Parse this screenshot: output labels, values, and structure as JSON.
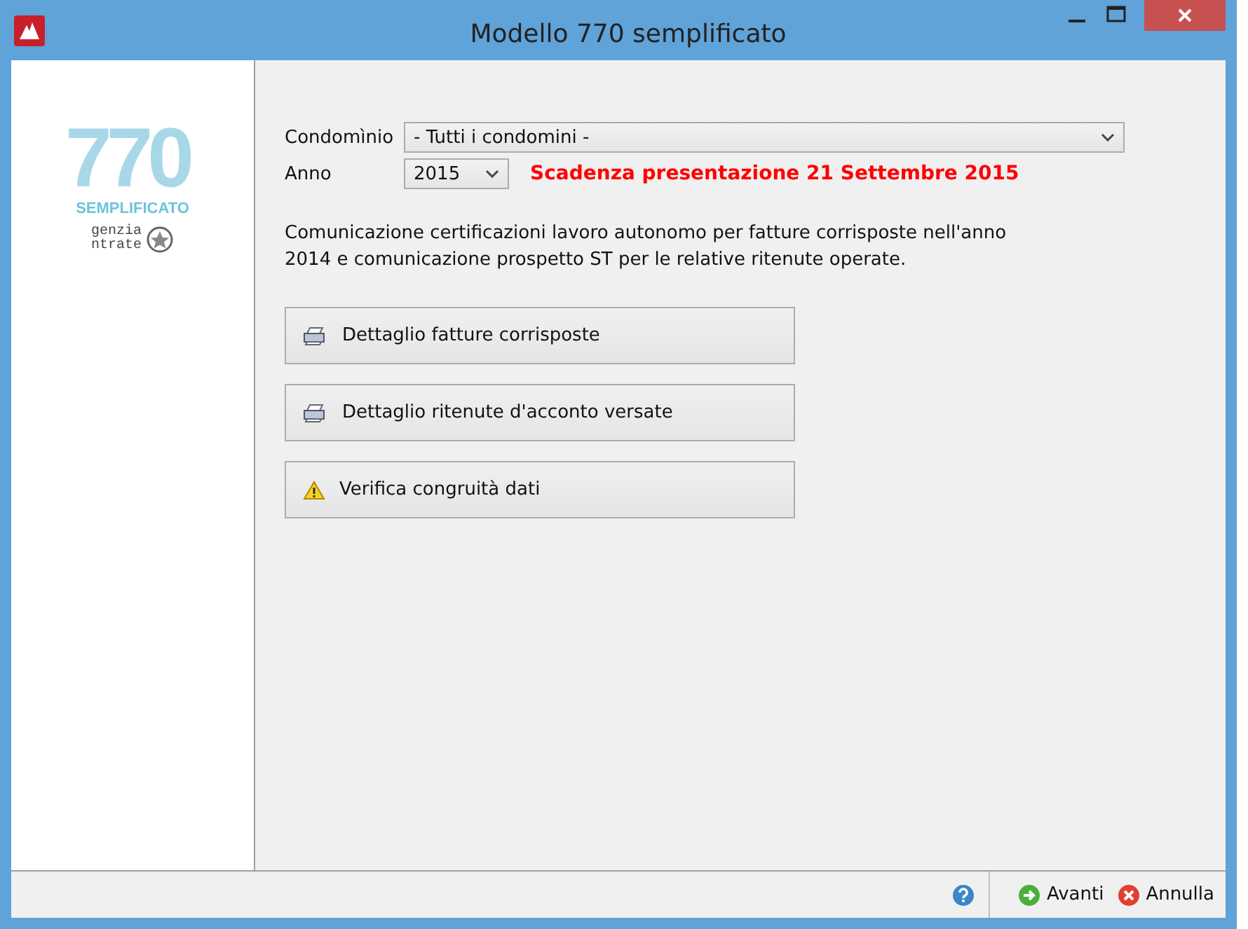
{
  "window": {
    "title": "Modello 770 semplificato"
  },
  "logo": {
    "number": "770",
    "caption": "SEMPLIFICATO",
    "agency_first": "genzia",
    "agency_second": "ntrate"
  },
  "form": {
    "condominio_label": "Condomìnio",
    "condominio_value": "- Tutti i condomini -",
    "anno_label": "Anno",
    "anno_value": "2015",
    "deadline": "Scadenza presentazione 21 Settembre 2015"
  },
  "description": "Comunicazione certificazioni lavoro autonomo per fatture corrisposte nell'anno 2014 e comunicazione prospetto ST per le relative ritenute operate.",
  "actions": [
    {
      "label": "Dettaglio fatture corrisposte",
      "kind": "printer"
    },
    {
      "label": "Dettaglio ritenute d'acconto versate",
      "kind": "printer"
    },
    {
      "label": "Verifica congruità dati",
      "kind": "warning"
    }
  ],
  "footer": [
    {
      "label": "Avanti",
      "kind": "next"
    },
    {
      "label": "Annulla",
      "kind": "cancel"
    }
  ]
}
